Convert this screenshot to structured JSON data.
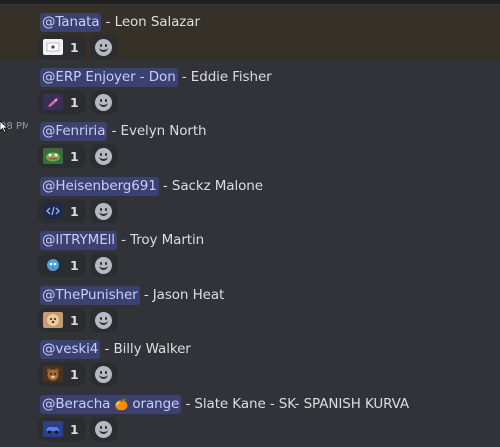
{
  "timestamp": "08 PM",
  "entries": [
    {
      "mention": "@Tanata",
      "rest": " - Leon Salazar",
      "reaction": {
        "icon": "flag-emoji",
        "count": "1"
      }
    },
    {
      "mention": "@ERP Enjoyer - Don",
      "rest": " - Eddie Fisher",
      "reaction": {
        "icon": "fish-emoji",
        "count": "1"
      }
    },
    {
      "mention": "@Fenriria",
      "rest": " - Evelyn North",
      "reaction": {
        "icon": "pepe-emoji",
        "count": "1"
      }
    },
    {
      "mention": "@Heisenberg691",
      "rest": " - Sackz Malone",
      "reaction": {
        "icon": "code-emoji",
        "count": "1"
      }
    },
    {
      "mention": "@IlTRYMEll",
      "rest": " - Troy Martin",
      "reaction": {
        "icon": "blob-emoji",
        "count": "1"
      }
    },
    {
      "mention": "@ThePunisher",
      "rest": " - Jason Heat",
      "reaction": {
        "icon": "dog-emoji",
        "count": "1"
      }
    },
    {
      "mention": "@veski4",
      "rest": " - Billy Walker",
      "reaction": {
        "icon": "bear-emoji",
        "count": "1"
      }
    },
    {
      "mention_pre": "@Beracha ",
      "mention_emoji": "🍊",
      "mention_post": " orange",
      "rest": " - Slate Kane - SK- SPANISH KURVA",
      "reaction": {
        "icon": "car-emoji",
        "count": "1"
      }
    }
  ],
  "colors": {
    "background": "#323339",
    "mention_bg": "#3c4270",
    "mention_text": "#c9cdfb",
    "highlight_row": "#353128"
  }
}
